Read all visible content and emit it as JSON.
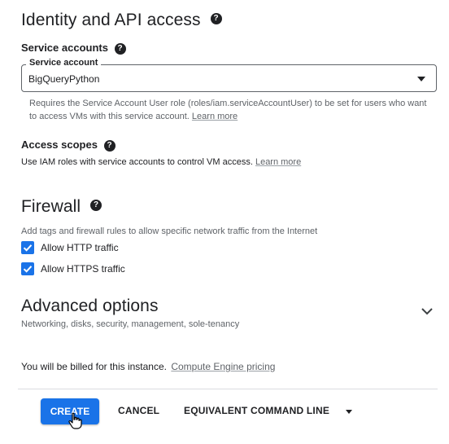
{
  "identity": {
    "title": "Identity and API access",
    "help_icon": "help-icon"
  },
  "service_accounts": {
    "heading": "Service accounts",
    "field_label": "Service account",
    "selected_value": "BigQueryPython",
    "description": "Requires the Service Account User role (roles/iam.serviceAccountUser) to be set for users who want to access VMs with this service account.",
    "learn_more": "Learn more"
  },
  "access_scopes": {
    "heading": "Access scopes",
    "description": "Use IAM roles with service accounts to control VM access.",
    "learn_more": "Learn more"
  },
  "firewall": {
    "title": "Firewall",
    "description": "Add tags and firewall rules to allow specific network traffic from the Internet",
    "options": [
      {
        "label": "Allow HTTP traffic",
        "checked": true
      },
      {
        "label": "Allow HTTPS traffic",
        "checked": true
      }
    ]
  },
  "advanced": {
    "title": "Advanced options",
    "subtitle": "Networking, disks, security, management, sole-tenancy"
  },
  "billing": {
    "notice": "You will be billed for this instance.",
    "pricing_link": "Compute Engine pricing"
  },
  "actions": {
    "create": "CREATE",
    "cancel": "CANCEL",
    "equivalent": "EQUIVALENT COMMAND LINE"
  },
  "colors": {
    "primary": "#1a73e8",
    "text": "#202124",
    "muted": "#5f6368"
  }
}
